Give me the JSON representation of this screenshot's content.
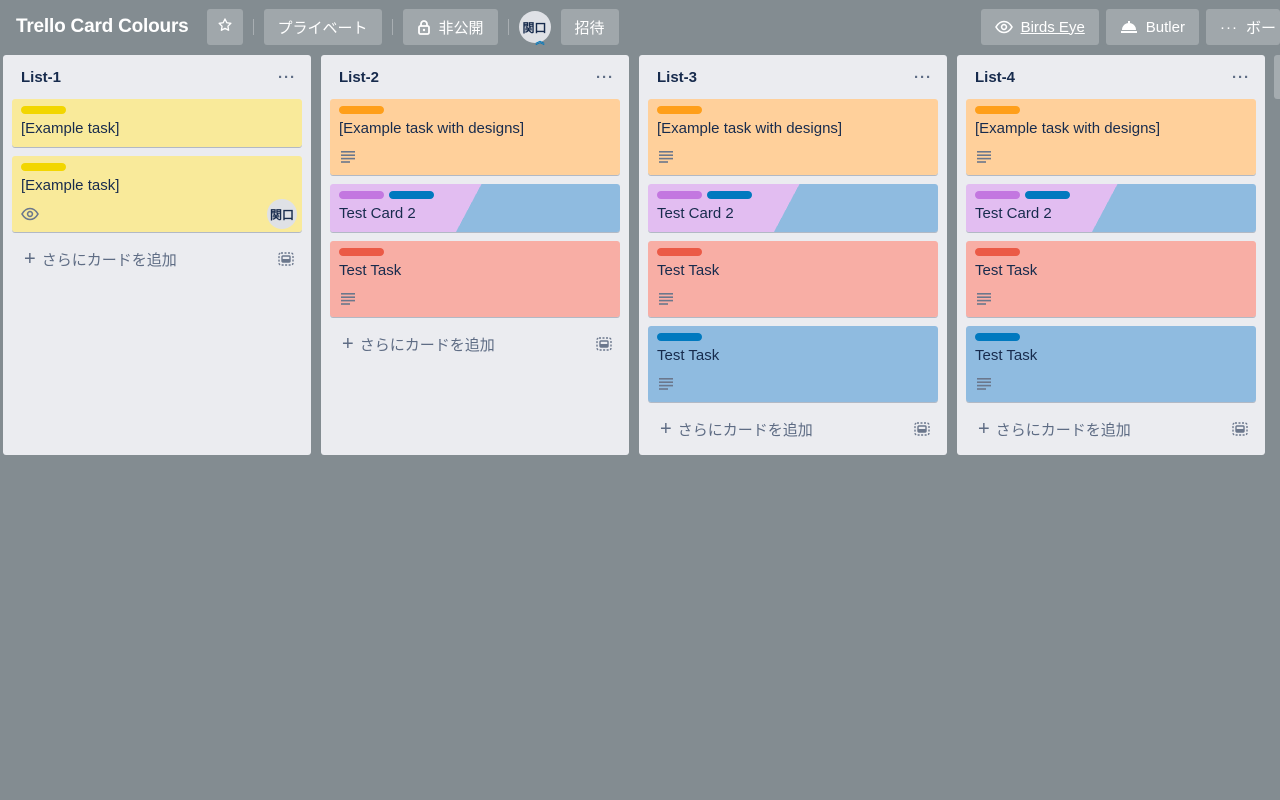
{
  "header": {
    "board_title": "Trello Card Colours",
    "visibility_label": "プライベート",
    "team_label": "非公開",
    "member_avatar": "関口",
    "invite_label": "招待",
    "birds_eye_label": "Birds Eye",
    "butler_label": "Butler",
    "menu_label": "ボー"
  },
  "colors": {
    "board_bg": "#838c91",
    "yellow_card": "#f9ea9a",
    "orange_card": "#ffd09b",
    "red_card": "#f8aea5",
    "blue_card": "#8fbbe0",
    "purple_card": "#e2bdf1",
    "label_yellow": "#f2d600",
    "label_orange": "#ff9f1a",
    "label_red": "#eb5a46",
    "label_blue": "#0079bf",
    "label_purple": "#c377e0"
  },
  "add_card_label": "さらにカードを追加",
  "lists": [
    {
      "title": "List-1",
      "cards": [
        {
          "title": "[Example task]",
          "labels": [
            "#f2d600"
          ],
          "bg": "#f9ea9a",
          "description": false,
          "watch": false,
          "member": ""
        },
        {
          "title": "[Example task]",
          "labels": [
            "#f2d600"
          ],
          "bg": "#f9ea9a",
          "description": false,
          "watch": true,
          "member": "関口"
        }
      ]
    },
    {
      "title": "List-2",
      "cards": [
        {
          "title": "[Example task with designs]",
          "labels": [
            "#ff9f1a"
          ],
          "bg": "#ffd09b",
          "description": true
        },
        {
          "title": "Test Card 2",
          "labels": [
            "#c377e0",
            "#0079bf"
          ],
          "bg": "split",
          "split": [
            "#e2bdf1",
            "#8fbbe0"
          ],
          "description": false
        },
        {
          "title": "Test Task",
          "labels": [
            "#eb5a46"
          ],
          "bg": "#f8aea5",
          "description": true
        }
      ]
    },
    {
      "title": "List-3",
      "cards": [
        {
          "title": "[Example task with designs]",
          "labels": [
            "#ff9f1a"
          ],
          "bg": "#ffd09b",
          "description": true
        },
        {
          "title": "Test Card 2",
          "labels": [
            "#c377e0",
            "#0079bf"
          ],
          "bg": "split",
          "split": [
            "#e2bdf1",
            "#8fbbe0"
          ],
          "description": false
        },
        {
          "title": "Test Task",
          "labels": [
            "#eb5a46"
          ],
          "bg": "#f8aea5",
          "description": true
        },
        {
          "title": "Test Task",
          "labels": [
            "#0079bf"
          ],
          "bg": "#8fbbe0",
          "description": true
        }
      ]
    },
    {
      "title": "List-4",
      "cards": [
        {
          "title": "[Example task with designs]",
          "labels": [
            "#ff9f1a"
          ],
          "bg": "#ffd09b",
          "description": true
        },
        {
          "title": "Test Card 2",
          "labels": [
            "#c377e0",
            "#0079bf"
          ],
          "bg": "split",
          "split": [
            "#e2bdf1",
            "#8fbbe0"
          ],
          "description": false
        },
        {
          "title": "Test Task",
          "labels": [
            "#eb5a46"
          ],
          "bg": "#f8aea5",
          "description": true
        },
        {
          "title": "Test Task",
          "labels": [
            "#0079bf"
          ],
          "bg": "#8fbbe0",
          "description": true
        }
      ]
    }
  ]
}
